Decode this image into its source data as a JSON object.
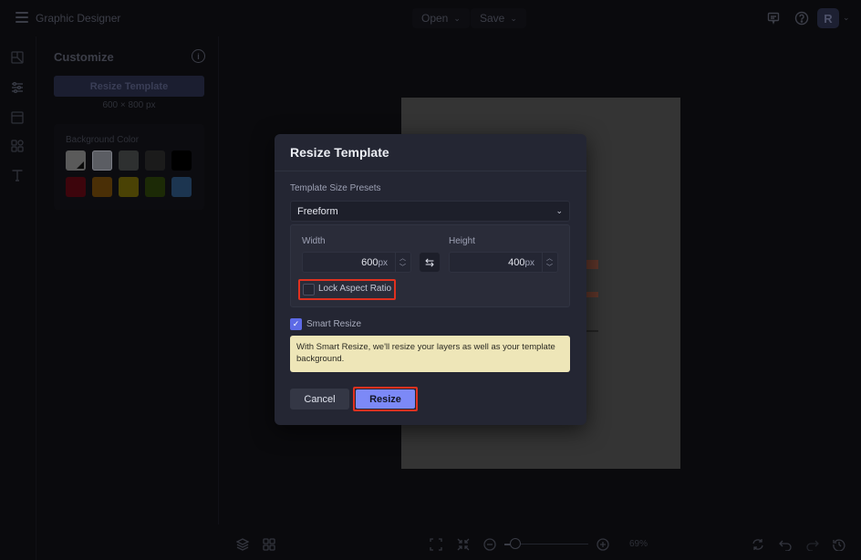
{
  "app": {
    "title": "Graphic Designer",
    "menus": [
      {
        "label": "Open",
        "chevron": "⌄"
      },
      {
        "label": "Save",
        "chevron": "⌄"
      }
    ],
    "top_icons": [
      "comments-icon",
      "help-icon"
    ],
    "avatar_initial": "R",
    "avatar_chevron": "⌄"
  },
  "rail": {
    "items": [
      "templates-icon",
      "customize-sliders-icon",
      "layout-icon",
      "elements-icon",
      "text-icon"
    ],
    "active": "customize-sliders-icon"
  },
  "panel": {
    "title": "Customize",
    "info_icon": "i",
    "resize_button_label": "Resize Template",
    "current_dimensions": "600 × 800 px",
    "background_color_label": "Background Color",
    "swatches": [
      {
        "name": "custom",
        "color": "#5a5a5a"
      },
      {
        "name": "light-gray",
        "color": "#5b5d63"
      },
      {
        "name": "gray",
        "color": "#2e3030"
      },
      {
        "name": "dark-gray",
        "color": "#1b1b1b"
      },
      {
        "name": "black",
        "color": "#000000"
      },
      {
        "name": "red",
        "color": "#3d050c"
      },
      {
        "name": "orange",
        "color": "#4a2f06"
      },
      {
        "name": "yellow",
        "color": "#4a4205"
      },
      {
        "name": "green",
        "color": "#1c2a06"
      },
      {
        "name": "blue",
        "color": "#1c3550"
      }
    ]
  },
  "dialog": {
    "title": "Resize Template",
    "presets_label": "Template Size Presets",
    "preset_value": "Freeform",
    "preset_chevron": "⌄",
    "width_label": "Width",
    "width_value": "600",
    "height_label": "Height",
    "height_value": "400",
    "unit": "px",
    "step_up": "︿",
    "step_down": "﹀",
    "swap_glyph": "⇆",
    "lock_aspect_label": "Lock Aspect Ratio",
    "lock_aspect_checked": false,
    "smart_resize_label": "Smart Resize",
    "smart_resize_checked": true,
    "check_glyph": "✓",
    "smart_resize_note": "With Smart Resize, we'll resize your layers as well as your template background.",
    "cancel_label": "Cancel",
    "resize_label": "Resize"
  },
  "bottombar": {
    "zoom_percent": "69%",
    "zoom_level": 0.08,
    "left_icons": [
      "layers-icon",
      "grid-icon"
    ],
    "center_icons": [
      "fit-screen-icon",
      "shrink-icon",
      "zoom-out-icon",
      "zoom-in-icon"
    ],
    "right_icons": [
      "sync-icon",
      "undo-icon",
      "redo-icon",
      "history-icon"
    ]
  },
  "colors": {
    "accent": "#7c89f7",
    "highlight": "#e0311f",
    "note_bg": "#eee6b8",
    "dialog_bg": "#242633"
  }
}
